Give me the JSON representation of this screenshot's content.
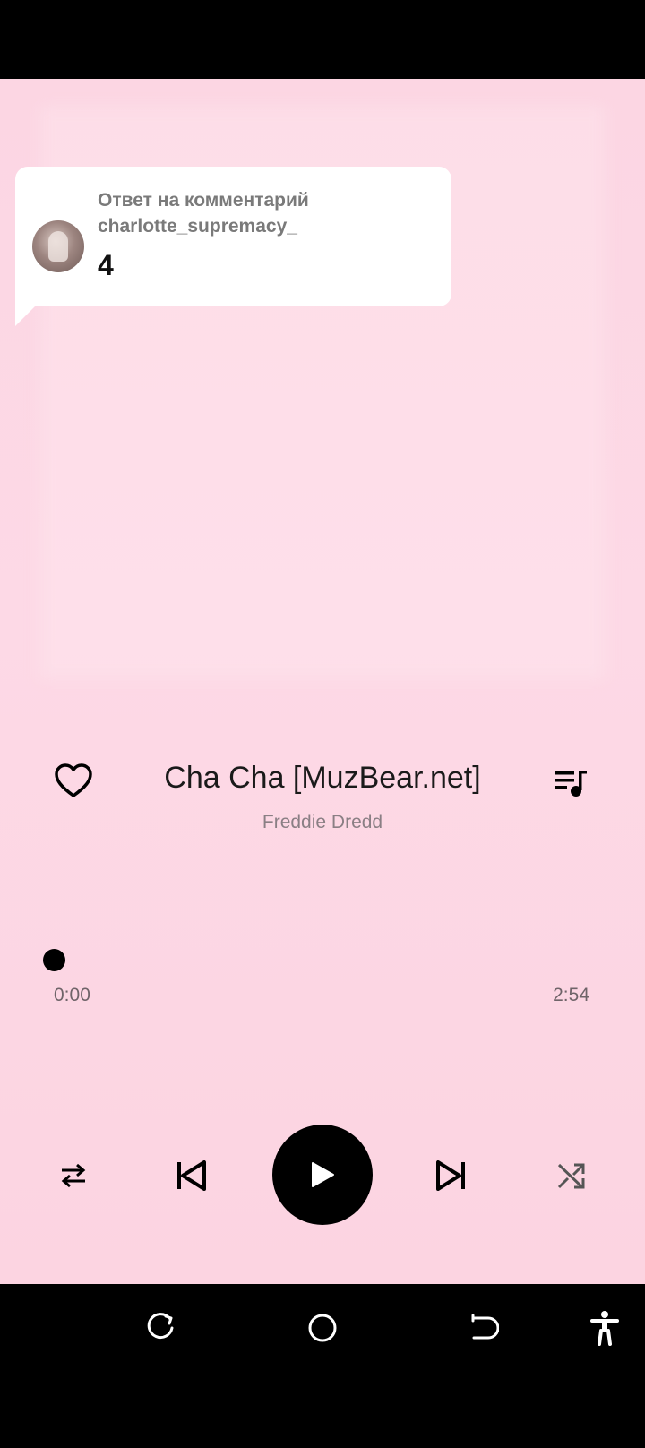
{
  "reply": {
    "label": "Ответ на комментарий",
    "username": "charlotte_supremacy_",
    "text": "4"
  },
  "track": {
    "title": "Cha Cha [MuzBear.net]",
    "artist": "Freddie Dredd"
  },
  "progress": {
    "current_time": "0:00",
    "total_time": "2:54",
    "fraction": 0.0
  },
  "icons": {
    "like": "heart-outline-icon",
    "queue": "playlist-icon",
    "repeat": "repeat-icon",
    "previous": "skip-previous-icon",
    "play": "play-icon",
    "next": "skip-next-icon",
    "shuffle": "shuffle-icon"
  },
  "colors": {
    "background": "#fcd6e3",
    "accent": "#000000",
    "title": "#1a1a1a",
    "subtitle": "#8a7f84"
  }
}
